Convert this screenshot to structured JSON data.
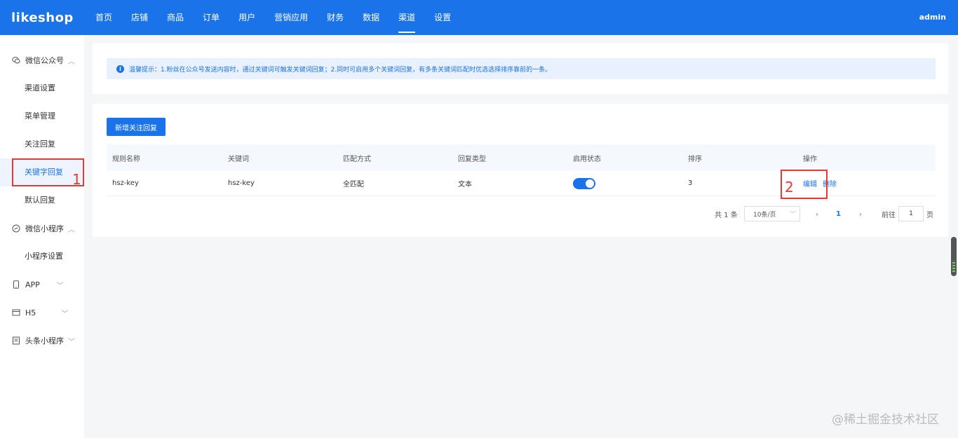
{
  "header": {
    "logo": "likeshop",
    "nav": [
      "首页",
      "店铺",
      "商品",
      "订单",
      "用户",
      "营销应用",
      "财务",
      "数据",
      "渠道",
      "设置"
    ],
    "active_nav": "渠道",
    "user": "admin"
  },
  "sidebar": {
    "groups": [
      {
        "label": "微信公众号",
        "icon": "wechat-icon",
        "expanded": true
      },
      {
        "label": "微信小程序",
        "icon": "mini-program-icon",
        "expanded": true
      },
      {
        "label": "APP",
        "icon": "phone-icon",
        "expanded": false
      },
      {
        "label": "H5",
        "icon": "h5-icon",
        "expanded": false
      },
      {
        "label": "头条小程序",
        "icon": "toutiao-icon",
        "expanded": false
      }
    ],
    "wechat_items": [
      "渠道设置",
      "菜单管理",
      "关注回复",
      "关键字回复",
      "默认回复"
    ],
    "mini_items": [
      "小程序设置"
    ],
    "active_item": "关键字回复"
  },
  "annotations": {
    "box1": "1",
    "box2": "2"
  },
  "tip": {
    "text": "温馨提示：1.粉丝在公众号发送内容时，通过关键词可触发关键词回复；2.同时可启用多个关键词回复，有多条关键词匹配时优选选择排序靠前的一条。"
  },
  "toolbar": {
    "add_label": "新增关注回复"
  },
  "table": {
    "columns": [
      "规则名称",
      "关键词",
      "匹配方式",
      "回复类型",
      "启用状态",
      "排序",
      "操作"
    ],
    "rows": [
      {
        "name": "hsz-key",
        "keyword": "hsz-key",
        "match": "全匹配",
        "type": "文本",
        "enabled": true,
        "sort": "3",
        "edit": "编辑",
        "delete": "删除"
      }
    ]
  },
  "pagination": {
    "total": "共 1 条",
    "page_size": "10条/页",
    "current": "1",
    "goto_label": "前往",
    "goto_value": "1",
    "page_suffix": "页"
  },
  "watermark": "@稀土掘金技术社区",
  "colors": {
    "primary": "#1a73e8",
    "annotation": "#e53935"
  }
}
